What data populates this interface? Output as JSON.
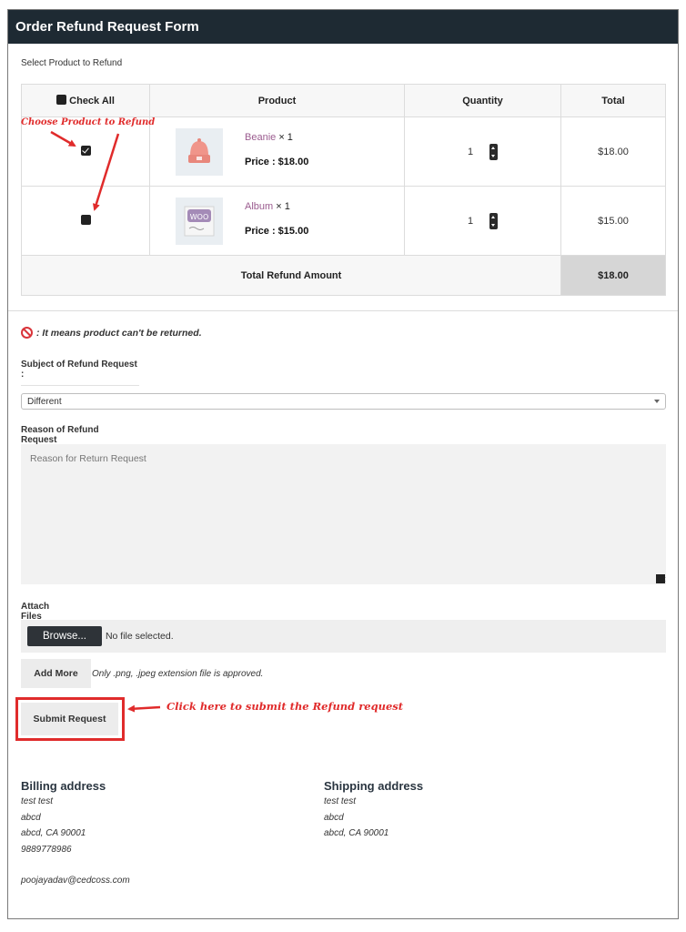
{
  "header": {
    "title": "Order Refund Request Form"
  },
  "select_label": "Select Product to Refund",
  "table": {
    "headers": {
      "check_all": "Check All",
      "product": "Product",
      "quantity": "Quantity",
      "total": "Total"
    },
    "rows": [
      {
        "checked": true,
        "name": "Beanie",
        "qty_suffix": "× 1",
        "price": "Price : $18.00",
        "quantity": "1",
        "total": "$18.00"
      },
      {
        "checked": false,
        "name": "Album",
        "qty_suffix": "× 1",
        "price": "Price : $15.00",
        "quantity": "1",
        "total": "$15.00"
      }
    ],
    "total_label": "Total Refund Amount",
    "total_value": "$18.00"
  },
  "note": ": It means product can't be returned.",
  "subject": {
    "label": "Subject of Refund Request :",
    "selected": "Different"
  },
  "reason": {
    "label": "Reason of Refund Request",
    "placeholder": "Reason for Return Request"
  },
  "attach": {
    "label": "Attach Files",
    "browse": "Browse...",
    "status": "No file selected."
  },
  "add_more": {
    "label": "Add More",
    "note": "Only .png, .jpeg extension file is approved."
  },
  "submit": {
    "label": "Submit Request"
  },
  "annotations": {
    "choose": "Choose Product to Refund",
    "submit": "Click here to submit the Refund request",
    "color": "#e02b2b"
  },
  "billing": {
    "title": "Billing address",
    "lines": [
      "test test",
      "abcd",
      "abcd, CA 90001",
      "9889778986"
    ],
    "email": "poojayadav@cedcoss.com"
  },
  "shipping": {
    "title": "Shipping address",
    "lines": [
      "test test",
      "abcd",
      "abcd, CA 90001"
    ]
  },
  "thumb_labels": {
    "album_logo": "WOO"
  },
  "colors": {
    "header_bg": "#1e2a33",
    "link": "#9b5c8f",
    "total_bg": "#d6d6d6"
  }
}
